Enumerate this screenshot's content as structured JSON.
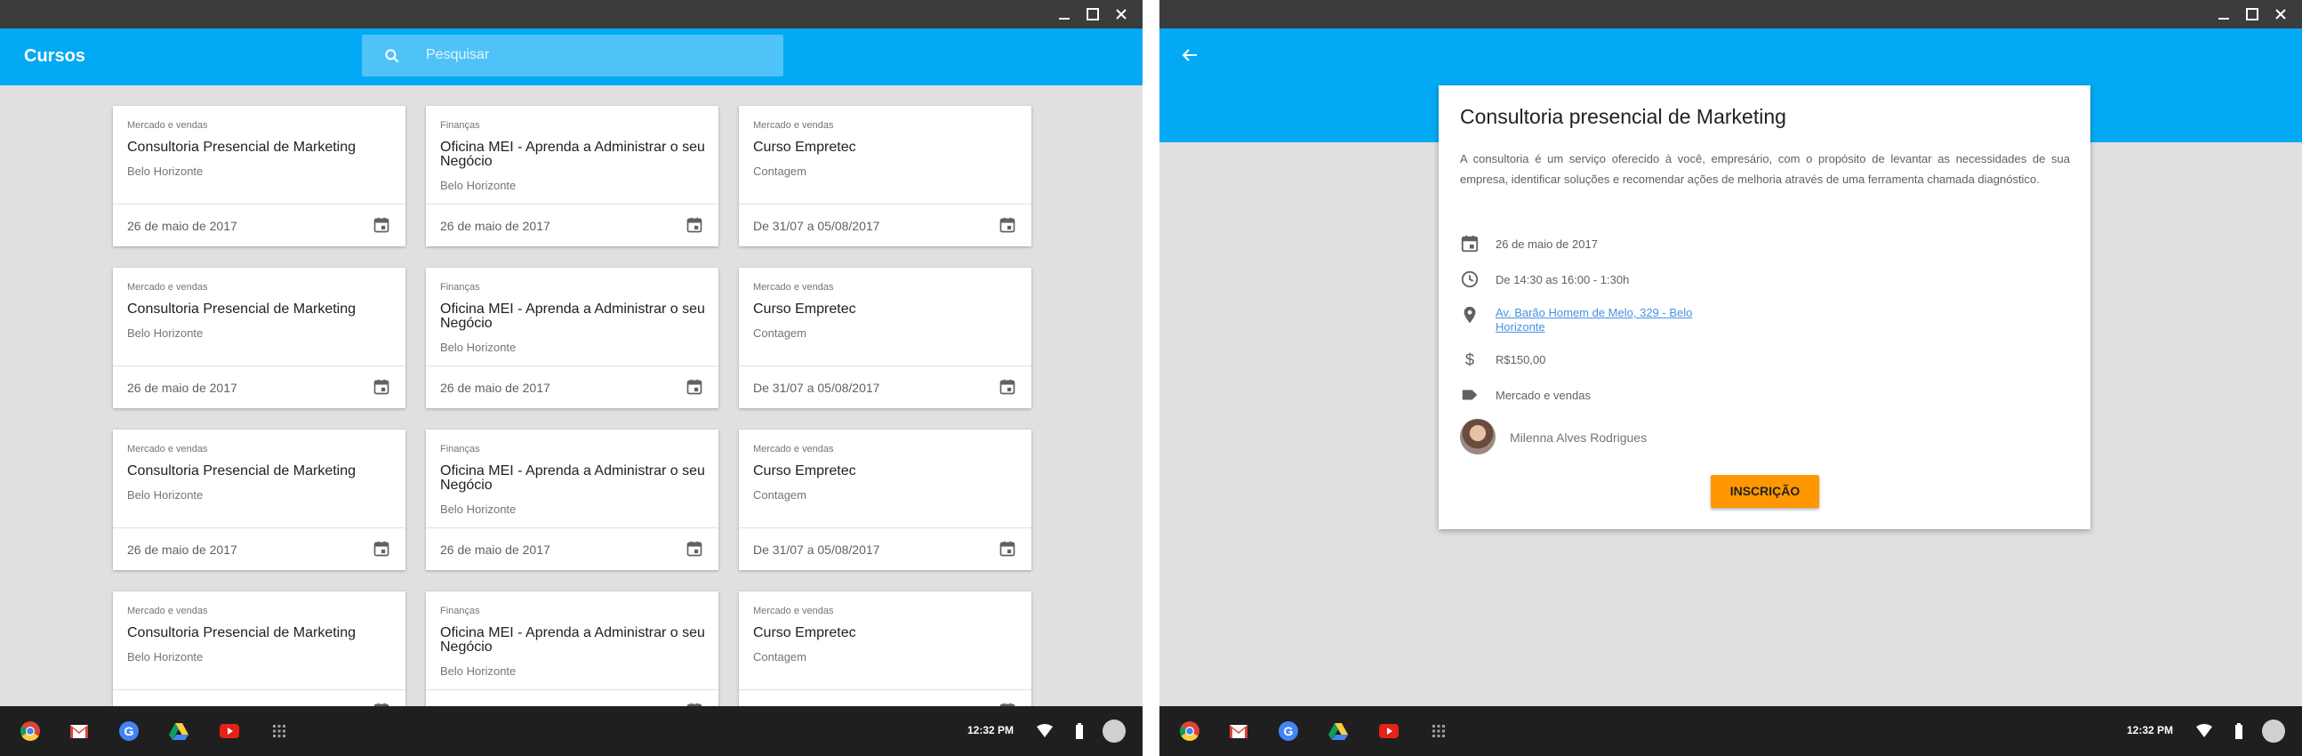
{
  "list_screen": {
    "app_title": "Cursos",
    "search": {
      "placeholder": "Pesquisar"
    },
    "courses": [
      {
        "category": "Mercado e vendas",
        "title": "Consultoria Presencial de Marketing",
        "city": "Belo Horizonte",
        "date": "26 de maio de 2017"
      },
      {
        "category": "Finanças",
        "title": "Oficina MEI - Aprenda a Administrar o seu Negócio",
        "city": "Belo Horizonte",
        "date": "26 de maio de 2017"
      },
      {
        "category": "Mercado e vendas",
        "title": "Curso Empretec",
        "city": "Contagem",
        "date": "De 31/07 a 05/08/2017"
      },
      {
        "category": "Mercado e vendas",
        "title": "Consultoria Presencial de Marketing",
        "city": "Belo Horizonte",
        "date": "26 de maio de 2017"
      },
      {
        "category": "Finanças",
        "title": "Oficina MEI - Aprenda a Administrar o seu Negócio",
        "city": "Belo Horizonte",
        "date": "26 de maio de 2017"
      },
      {
        "category": "Mercado e vendas",
        "title": "Curso Empretec",
        "city": "Contagem",
        "date": "De 31/07 a 05/08/2017"
      },
      {
        "category": "Mercado e vendas",
        "title": "Consultoria Presencial de Marketing",
        "city": "Belo Horizonte",
        "date": "26 de maio de 2017"
      },
      {
        "category": "Finanças",
        "title": "Oficina MEI - Aprenda a Administrar o seu Negócio",
        "city": "Belo Horizonte",
        "date": "26 de maio de 2017"
      },
      {
        "category": "Mercado e vendas",
        "title": "Curso Empretec",
        "city": "Contagem",
        "date": "De 31/07 a 05/08/2017"
      },
      {
        "category": "Mercado e vendas",
        "title": "Consultoria Presencial de Marketing",
        "city": "Belo Horizonte",
        "date": ""
      },
      {
        "category": "Finanças",
        "title": "Oficina MEI - Aprenda a Administrar o seu Negócio",
        "city": "Belo Horizonte",
        "date": ""
      },
      {
        "category": "Mercado e vendas",
        "title": "Curso Empretec",
        "city": "Contagem",
        "date": ""
      }
    ]
  },
  "detail_screen": {
    "title": "Consultoria presencial de Marketing",
    "description": "A consultoria é um serviço oferecido à você, empresário, com o propósito de levantar as necessidades de sua empresa, identificar soluções e recomendar ações de melhoria através de uma ferramenta chamada diagnóstico.",
    "date": "26 de maio de 2017",
    "time": "De 14:30 as 16:00 - 1:30h",
    "address": "Av. Barão Homem de Melo, 329 - Belo Horizonte",
    "price": "R$150,00",
    "category": "Mercado e vendas",
    "host": "Milenna Alves Rodrigues",
    "enroll_label": "INSCRIÇÃO"
  },
  "taskbar": {
    "time": "12:32 PM"
  },
  "colors": {
    "primary": "#03a9f4",
    "accent": "#ff9800",
    "background": "#e0e0e0"
  }
}
